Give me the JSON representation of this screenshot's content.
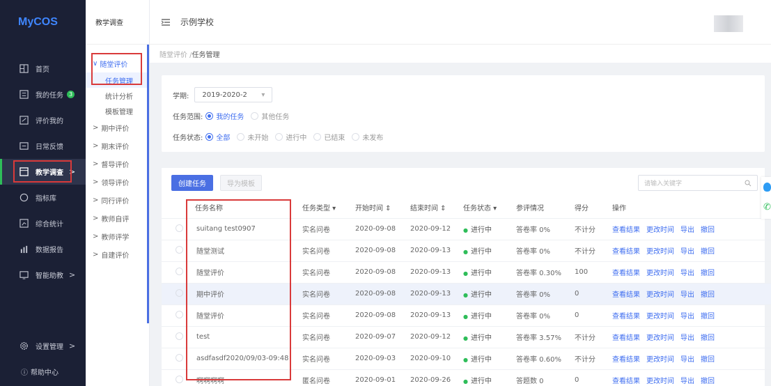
{
  "sidebar": {
    "logo": "MyCOS",
    "items": [
      {
        "label": "首页",
        "icon": "home-icon"
      },
      {
        "label": "我的任务",
        "icon": "task-icon",
        "badge": "3"
      },
      {
        "label": "评价我的",
        "icon": "evaluate-icon"
      },
      {
        "label": "日常反馈",
        "icon": "feedback-icon"
      },
      {
        "label": "教学调查",
        "icon": "survey-icon",
        "arrow": ">"
      },
      {
        "label": "指标库",
        "icon": "index-icon"
      },
      {
        "label": "综合统计",
        "icon": "stats-icon"
      },
      {
        "label": "数据报告",
        "icon": "report-icon"
      },
      {
        "label": "智能助教",
        "icon": "assistant-icon",
        "arrow": ">"
      }
    ],
    "settings": {
      "label": "设置管理",
      "arrow": ">"
    },
    "help": "帮助中心"
  },
  "subbar": {
    "title": "教学调查",
    "open_group": "随堂评价",
    "children": [
      "任务管理",
      "统计分析",
      "模板管理"
    ],
    "groups": [
      "期中评价",
      "期末评价",
      "督导评价",
      "领导评价",
      "同行评价",
      "教师自评",
      "教师评学",
      "自建评价"
    ]
  },
  "header": {
    "school": "示例学校"
  },
  "breadcrumb": {
    "parent": "随堂评价 / ",
    "current": "任务管理"
  },
  "filters": {
    "term_label": "学期:",
    "term_value": "2019-2020-2",
    "scope_label": "任务范围:",
    "scope_options": [
      "我的任务",
      "其他任务"
    ],
    "status_label": "任务状态:",
    "status_options": [
      "全部",
      "未开始",
      "进行中",
      "已结束",
      "未发布"
    ]
  },
  "toolbar": {
    "create": "创建任务",
    "export_template": "导为模板",
    "search_placeholder": "请输入关键字"
  },
  "table": {
    "headers": [
      "任务名称",
      "任务类型 ▾",
      "开始时间 ⇕",
      "结束时间 ⇕",
      "任务状态 ▾",
      "参评情况",
      "得分",
      "操作"
    ],
    "actions": [
      "查看结果",
      "更改时间",
      "导出",
      "撤回"
    ],
    "rows": [
      {
        "name": "suitang test0907",
        "type": "实名问卷",
        "start": "2020-09-08",
        "end": "2020-09-12",
        "status": "进行中",
        "participation": "答卷率 0%",
        "score": "不计分"
      },
      {
        "name": "随堂测试",
        "type": "实名问卷",
        "start": "2020-09-08",
        "end": "2020-09-13",
        "status": "进行中",
        "participation": "答卷率 0%",
        "score": "不计分"
      },
      {
        "name": "随堂评价",
        "type": "实名问卷",
        "start": "2020-09-08",
        "end": "2020-09-13",
        "status": "进行中",
        "participation": "答卷率 0.30%",
        "score": "100"
      },
      {
        "name": "期中评价",
        "type": "实名问卷",
        "start": "2020-09-08",
        "end": "2020-09-13",
        "status": "进行中",
        "participation": "答卷率 0%",
        "score": "0"
      },
      {
        "name": "随堂评价",
        "type": "实名问卷",
        "start": "2020-09-08",
        "end": "2020-09-13",
        "status": "进行中",
        "participation": "答卷率 0%",
        "score": "0"
      },
      {
        "name": "test",
        "type": "实名问卷",
        "start": "2020-09-07",
        "end": "2020-09-12",
        "status": "进行中",
        "participation": "答卷率 3.57%",
        "score": "不计分"
      },
      {
        "name": "asdfasdf2020/09/03-09:48",
        "type": "实名问卷",
        "start": "2020-09-03",
        "end": "2020-09-10",
        "status": "进行中",
        "participation": "答卷率 0.60%",
        "score": "不计分"
      },
      {
        "name": "啊啊啊啊",
        "type": "匿名问卷",
        "start": "2020-09-01",
        "end": "2020-09-26",
        "status": "进行中",
        "participation": "答题数 0",
        "score": "0"
      }
    ]
  },
  "colors": {
    "sidebar_bg": "#1b2035",
    "primary": "#4a6fe3",
    "success": "#2ebd59",
    "highlight_box": "#d93a3a"
  }
}
